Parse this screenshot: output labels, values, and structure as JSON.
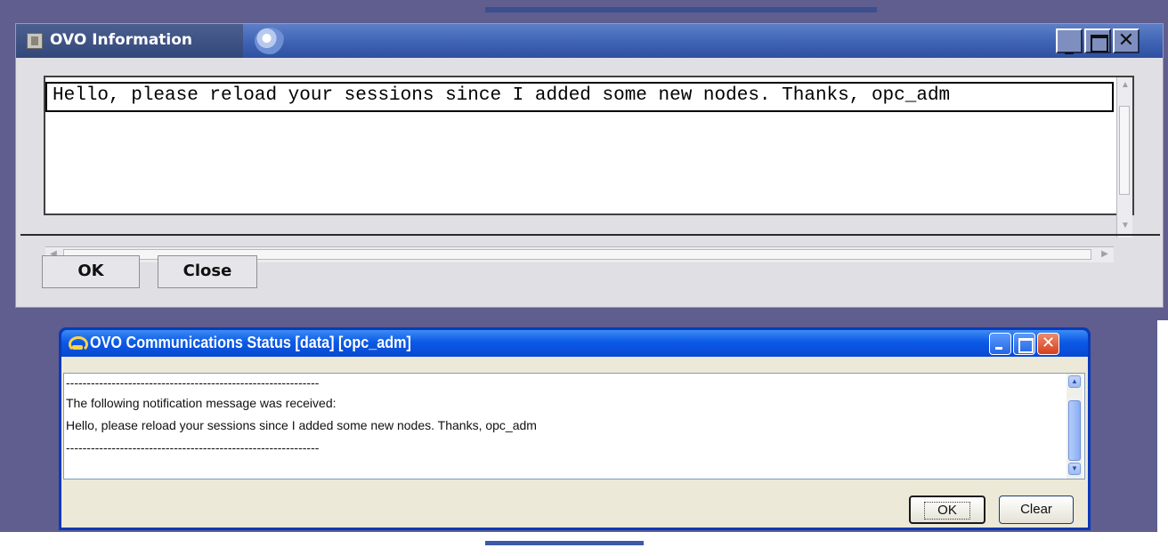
{
  "info_window": {
    "title": "OVO Information",
    "message": "Hello, please reload your sessions since I added some new nodes. Thanks, opc_adm",
    "ok_label": "OK",
    "close_label": "Close",
    "controls": {
      "minimize": "_",
      "close": "✕"
    }
  },
  "comm_window": {
    "title": "OVO Communications Status  [data] [opc_adm]",
    "lines": [
      "-------------------------------------------------------------",
      "The following notification message was received:",
      "Hello, please reload your sessions since I added some new nodes. Thanks, opc_adm",
      "-------------------------------------------------------------"
    ],
    "ok_label": "OK",
    "clear_label": "Clear",
    "controls": {
      "close": "✕"
    }
  },
  "colors": {
    "desktop": "#5f5e8e",
    "motif_titlebar": "#3f63b4",
    "xp_titlebar": "#0b5ae6",
    "xp_close": "#d5401e"
  },
  "icons": [
    "ovo-app-icon",
    "swirl-icon",
    "comm-status-icon"
  ]
}
